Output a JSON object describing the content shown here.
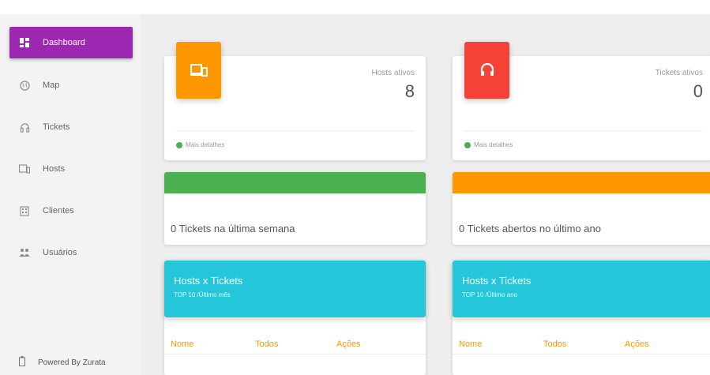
{
  "sidebar": {
    "items": [
      {
        "label": "Dashboard",
        "icon": "dashboard-icon",
        "active": true
      },
      {
        "label": "Map",
        "icon": "globe-icon"
      },
      {
        "label": "Tickets",
        "icon": "headset-icon"
      },
      {
        "label": "Hosts",
        "icon": "devices-icon"
      },
      {
        "label": "Clientes",
        "icon": "building-icon"
      },
      {
        "label": "Usuários",
        "icon": "users-icon"
      }
    ],
    "powered_by": "Powered By Zurata"
  },
  "cards": {
    "hosts": {
      "label": "Hosts ativos",
      "value": "8",
      "footer": "Mais detalhes",
      "color": "#ff9800"
    },
    "tickets": {
      "label": "Tickets ativos",
      "value": "0",
      "footer": "Mais detalhes",
      "color": "#f44336"
    }
  },
  "charts": {
    "week": {
      "text": "0 Tickets na última semana",
      "color": "#4caf50"
    },
    "year": {
      "text": "0 Tickets abertos no último ano",
      "color": "#ff9800"
    }
  },
  "tables": {
    "month": {
      "title": "Hosts x Tickets",
      "subtitle": "TOP 10 /Último mês",
      "columns": [
        "Nome",
        "Todos",
        "Ações"
      ]
    },
    "year": {
      "title": "Hosts x Tickets",
      "subtitle": "TOP 10 /Último ano",
      "columns": [
        "Nome",
        "Todos",
        "Ações"
      ]
    }
  },
  "colors": {
    "accent": "#9c27b0",
    "info": "#26c6da"
  }
}
